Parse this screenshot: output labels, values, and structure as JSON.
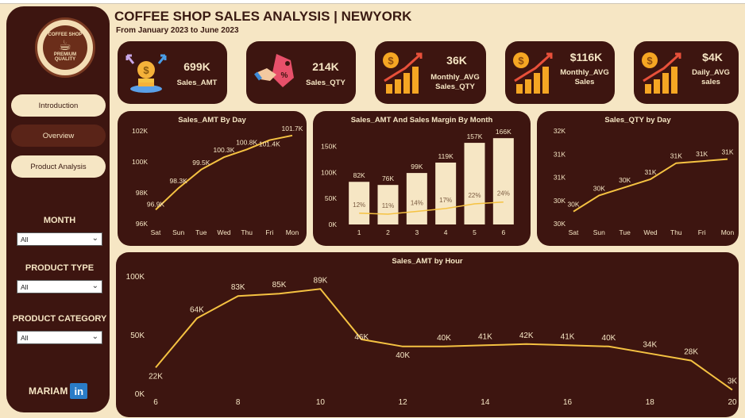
{
  "header": {
    "title": "COFFEE SHOP SALES ANALYSIS | NEWYORK",
    "subtitle": "From January 2023 to June 2023"
  },
  "sidebar": {
    "logo_text_top": "COFFEE SHOP",
    "logo_text_bottom": "PREMIUM QUALITY",
    "nav": [
      {
        "label": "Introduction"
      },
      {
        "label": "Overview"
      },
      {
        "label": "Product Analysis"
      }
    ],
    "filters": [
      {
        "label": "MONTH",
        "value": "All"
      },
      {
        "label": "PRODUCT TYPE",
        "value": "All"
      },
      {
        "label": "PRODUCT CATEGORY",
        "value": "All"
      }
    ],
    "brand": "MARIAM",
    "brand_icon": "in"
  },
  "kpis": [
    {
      "value": "699K",
      "label": "Sales_AMT",
      "icon": "money-bag-icon"
    },
    {
      "value": "214K",
      "label": "Sales_QTY",
      "icon": "handshake-tag-icon"
    },
    {
      "value": "36K",
      "label": "Monthly_AVG Sales_QTY",
      "icon": "growth-chart-icon"
    },
    {
      "value": "$116K",
      "label": "Monthly_AVG Sales",
      "icon": "growth-chart-icon"
    },
    {
      "value": "$4K",
      "label": "Daily_AVG sales",
      "icon": "growth-chart-icon"
    }
  ],
  "colors": {
    "background": "#f6e6c4",
    "panel": "#3d1510",
    "bar": "#f6e6c4",
    "line": "#f5c242",
    "text_light": "#f6e6c4"
  },
  "chart_data": [
    {
      "type": "line",
      "title": "Sales_AMT By Day",
      "categories": [
        "Sat",
        "Sun",
        "Tue",
        "Wed",
        "Thu",
        "Fri",
        "Mon"
      ],
      "values": [
        96.9,
        98.3,
        99.5,
        100.3,
        100.8,
        101.4,
        101.7
      ],
      "labels": [
        "96.9K",
        "98.3K",
        "99.5K",
        "100.3K",
        "100.8K",
        "101.4K",
        "101.7K"
      ],
      "yticks": [
        "96K",
        "98K",
        "100K",
        "102K"
      ],
      "ylim": [
        96,
        102
      ]
    },
    {
      "type": "bar",
      "title": "Sales_AMT And Sales Margin By Month",
      "categories": [
        "1",
        "2",
        "3",
        "4",
        "5",
        "6"
      ],
      "values": [
        82,
        76,
        99,
        119,
        157,
        166
      ],
      "labels": [
        "82K",
        "76K",
        "99K",
        "119K",
        "157K",
        "166K"
      ],
      "margin_values": [
        12,
        11,
        14,
        17,
        22,
        24
      ],
      "margin_labels": [
        "12%",
        "11%",
        "14%",
        "17%",
        "22%",
        "24%"
      ],
      "yticks": [
        "0K",
        "50K",
        "100K",
        "150K"
      ],
      "ylim": [
        0,
        180
      ]
    },
    {
      "type": "line",
      "title": "Sales_QTY by Day",
      "categories": [
        "Sat",
        "Sun",
        "Tue",
        "Wed",
        "Thu",
        "Fri",
        "Mon"
      ],
      "values": [
        30.0,
        30.4,
        30.6,
        30.8,
        31.2,
        31.25,
        31.3
      ],
      "labels": [
        "30K",
        "30K",
        "30K",
        "31K",
        "31K",
        "31K",
        "31K"
      ],
      "yticks": [
        "30K",
        "30K",
        "31K",
        "31K",
        "32K"
      ],
      "ylim": [
        29.7,
        32.0
      ]
    },
    {
      "type": "line",
      "title": "Sales_AMT by Hour",
      "x": [
        6,
        7,
        8,
        9,
        10,
        11,
        12,
        13,
        14,
        15,
        16,
        17,
        18,
        19,
        20
      ],
      "values": [
        22,
        64,
        83,
        85,
        89,
        46,
        40,
        40,
        41,
        42,
        41,
        40,
        34,
        28,
        3
      ],
      "labels": [
        "22K",
        "64K",
        "83K",
        "85K",
        "89K",
        "46K",
        "40K",
        "40K",
        "41K",
        "42K",
        "41K",
        "40K",
        "34K",
        "28K",
        "3K"
      ],
      "xticks": [
        "6",
        "8",
        "10",
        "12",
        "14",
        "16",
        "18",
        "20"
      ],
      "yticks": [
        "0K",
        "50K",
        "100K"
      ],
      "ylim": [
        0,
        100
      ]
    }
  ]
}
